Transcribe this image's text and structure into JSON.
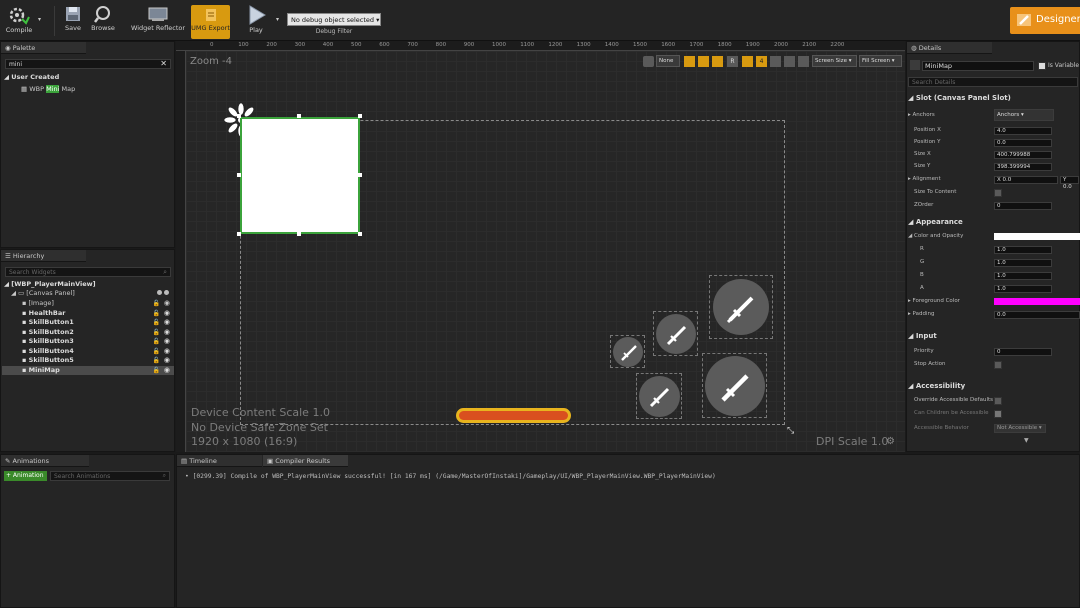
{
  "toolbar": {
    "compile": "Compile",
    "save": "Save",
    "browse": "Browse",
    "widget_reflector": "Widget Reflector",
    "umg_export": "UMG Export",
    "play": "Play",
    "debug_object": "No debug object selected",
    "debug_filter": "Debug Filter",
    "designer": "Designer"
  },
  "palette": {
    "tab": "Palette",
    "search": "mini",
    "category": "User Created",
    "item_prefix": "WBP ",
    "item_highlight": "Mini",
    "item_suffix": " Map"
  },
  "hierarchy": {
    "tab": "Hierarchy",
    "search_placeholder": "Search Widgets",
    "root": "[WBP_PlayerMainView]",
    "canvas": "[Canvas Panel]",
    "items": [
      "[Image]",
      "HealthBar",
      "SkillButton1",
      "SkillButton2",
      "SkillButton3",
      "SkillButton4",
      "SkillButton5",
      "MiniMap"
    ]
  },
  "animations": {
    "tab": "Animations",
    "add": "+ Animation",
    "search_placeholder": "Search Animations"
  },
  "bottom_tabs": {
    "timeline": "Timeline",
    "compiler": "Compiler Results"
  },
  "log": "• [0299.39] Compile of WBP_PlayerMainView successful! [in 167 ms] (/Game/MasterOfInstaki]/Gameplay/UI/WBP_PlayerMainView.WBP_PlayerMainView)",
  "canvas": {
    "zoom": "Zoom -4",
    "none_btn": "None",
    "screen_size": "Screen Size",
    "fill_screen": "Fill Screen",
    "info1": "Device Content Scale 1.0",
    "info2": "No Device Safe Zone Set",
    "info3": "1920 x 1080 (16:9)",
    "dpi": "DPI Scale 1.0",
    "ruler": [
      "0",
      "100",
      "200",
      "300",
      "400",
      "500",
      "600",
      "700",
      "800",
      "900",
      "1000",
      "1100",
      "1200",
      "1300",
      "1400",
      "1500",
      "1600",
      "1700",
      "1800",
      "1900",
      "2000",
      "2100",
      "2200"
    ]
  },
  "details": {
    "tab": "Details",
    "name": "MiniMap",
    "is_variable": "Is Variable",
    "search_placeholder": "Search Details",
    "slot_section": "Slot (Canvas Panel Slot)",
    "anchors_label": "Anchors",
    "anchors_value": "Anchors",
    "position_x_label": "Position X",
    "position_x": "4.0",
    "position_y_label": "Position Y",
    "position_y": "0.0",
    "size_x_label": "Size X",
    "size_x": "400.799988",
    "size_y_label": "Size Y",
    "size_y": "398.399994",
    "alignment_label": "Alignment",
    "align_x": "X  0.0",
    "align_y": "Y  0.0",
    "size_to_content": "Size To Content",
    "zorder_label": "ZOrder",
    "zorder": "0",
    "appearance_section": "Appearance",
    "color_opacity": "Color and Opacity",
    "r_label": "R",
    "r": "1.0",
    "g_label": "G",
    "g": "1.0",
    "b_label": "B",
    "b": "1.0",
    "a_label": "A",
    "a": "1.0",
    "foreground": "Foreground Color",
    "padding_label": "Padding",
    "padding": "0.0",
    "input_section": "Input",
    "priority_label": "Priority",
    "priority": "0",
    "stop_action": "Stop Action",
    "accessibility_section": "Accessibility",
    "override_accessible": "Override Accessible Defaults",
    "can_children": "Can Children be Accessible",
    "accessible_behavior": "Accessible Behavior",
    "accessible_value": "Not Accessible"
  },
  "colors": {
    "accent": "#e8901a",
    "umg": "#d89a10",
    "selection": "#3ba33b",
    "foreground": "#ff00ff",
    "healthbar": "#d9501f"
  }
}
